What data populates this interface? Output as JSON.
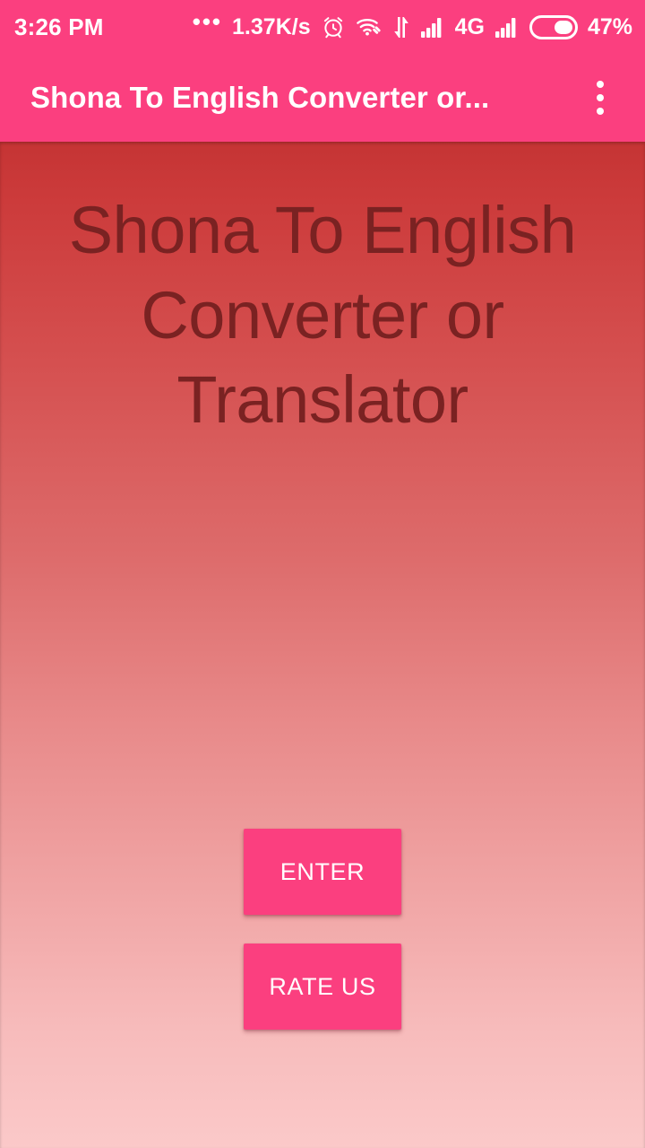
{
  "status_bar": {
    "time": "3:26 PM",
    "overflow_dots": "•••",
    "network_speed": "1.37K/s",
    "alarm_icon": "alarm-clock-icon",
    "wifi_icon": "wifi-icon",
    "data_transfer_icon": "data-transfer-arrows-icon",
    "signal_one_icon": "signal-bars-icon",
    "network_type": "4G",
    "signal_two_icon": "signal-bars-icon",
    "battery_icon": "battery-icon",
    "battery_percent": "47%",
    "battery_level": 47
  },
  "app_bar": {
    "title": "Shona To English Converter or...",
    "overflow_menu": "overflow-menu-icon",
    "background_color": "#FB3F7F",
    "title_color": "#FFFFFF"
  },
  "main": {
    "headline": "Shona To English Converter or Translator",
    "headline_color": "#7A2222",
    "background_gradient_top": "#C53434",
    "background_gradient_bottom": "#FBC9C9",
    "buttons": [
      {
        "label": "ENTER",
        "color": "#FB3F7F",
        "text_color": "#FFFFFF"
      },
      {
        "label": "RATE US",
        "color": "#FB3F7F",
        "text_color": "#FFFFFF"
      }
    ]
  }
}
